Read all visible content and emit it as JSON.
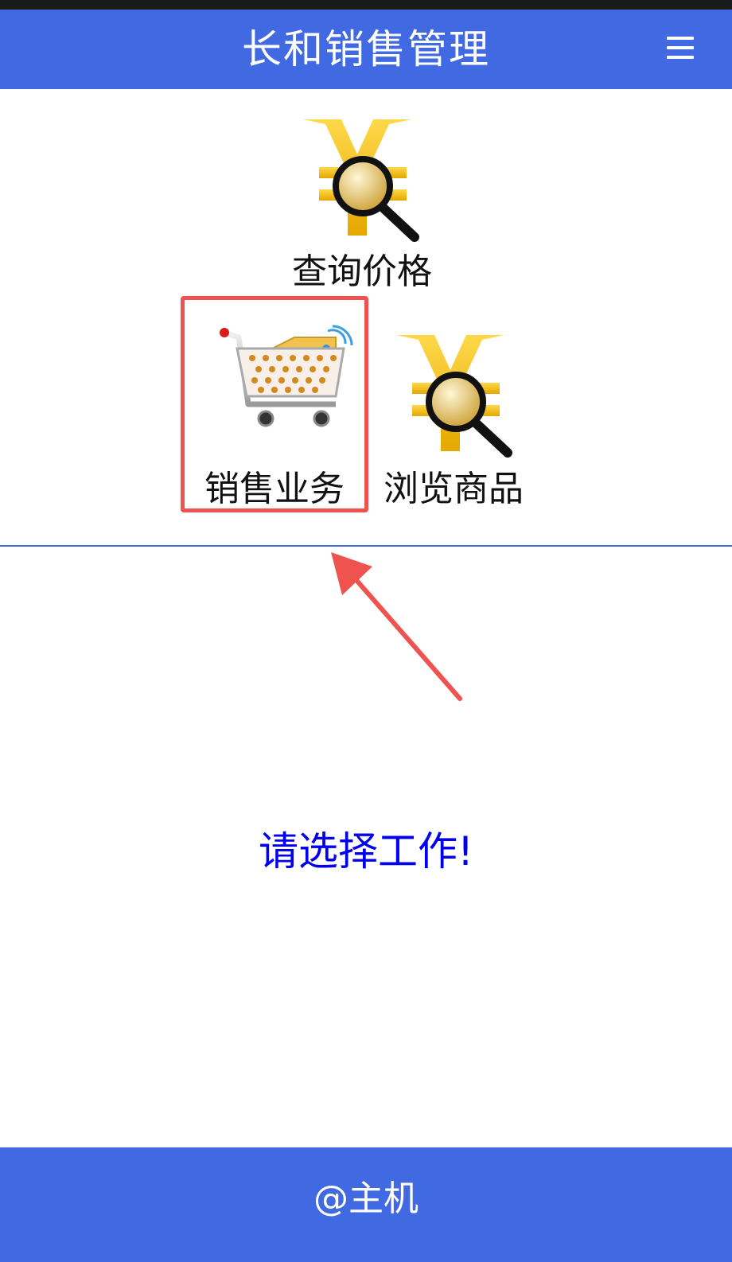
{
  "header": {
    "title": "长和销售管理",
    "menu_icon": "hamburger-menu-icon"
  },
  "tiles": [
    {
      "label": "查询价格",
      "icon": "yen-search-icon"
    },
    {
      "label": "销售业务",
      "icon": "shopping-cart-icon"
    },
    {
      "label": "浏览商品",
      "icon": "yen-search-icon"
    }
  ],
  "main": {
    "prompt": "请选择工作!"
  },
  "footer": {
    "text": "@主机"
  },
  "colors": {
    "brand": "#4169e1",
    "prompt": "#0000ee",
    "highlight": "#ef5350"
  }
}
